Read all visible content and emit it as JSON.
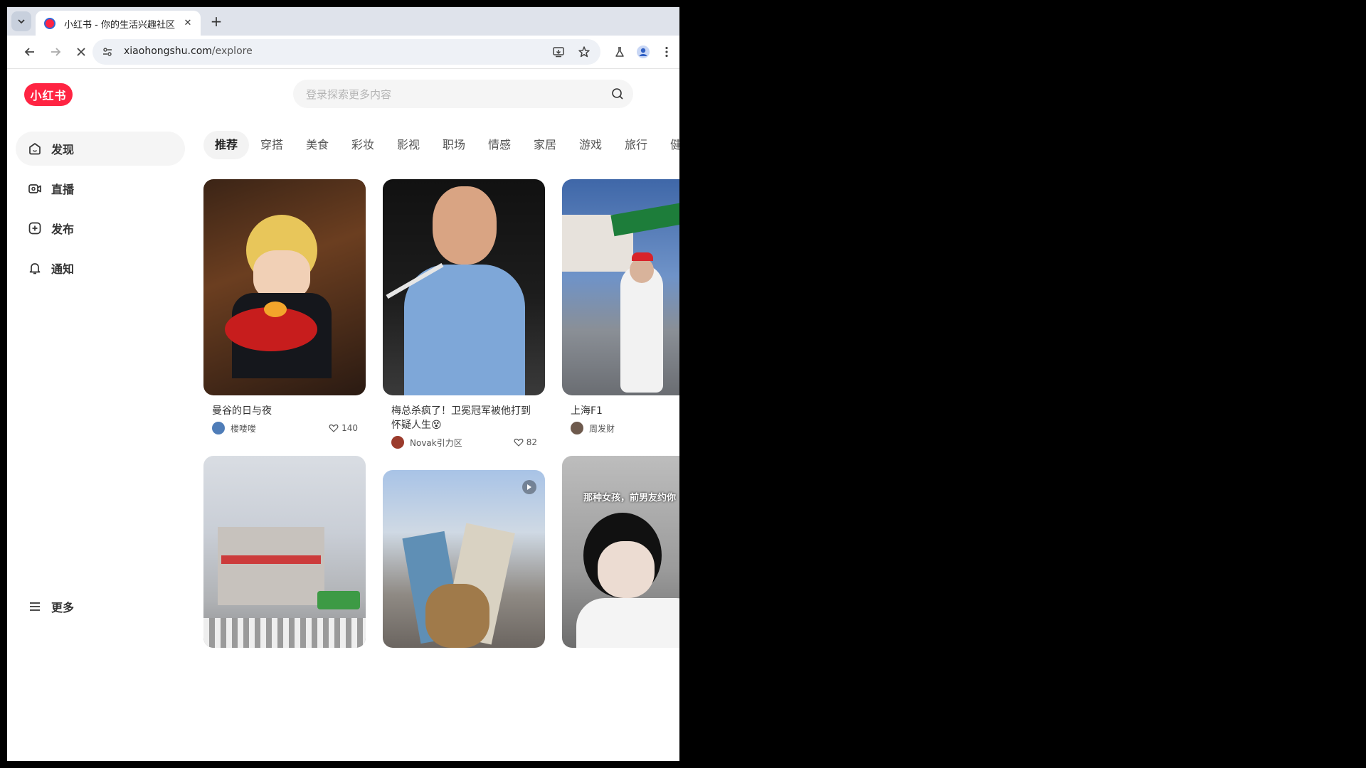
{
  "browser": {
    "tab_title": "小红书 - 你的生活兴趣社区",
    "url_host": "xiaohongshu.com",
    "url_path": "/explore"
  },
  "page": {
    "logo_text": "小红书",
    "search_placeholder": "登录探索更多内容",
    "sidebar": {
      "items": [
        {
          "label": "发现",
          "icon": "home-icon",
          "active": true
        },
        {
          "label": "直播",
          "icon": "live-icon"
        },
        {
          "label": "发布",
          "icon": "add-icon"
        },
        {
          "label": "通知",
          "icon": "bell-icon"
        }
      ],
      "more_label": "更多"
    },
    "channels": [
      "推荐",
      "穿搭",
      "美食",
      "彩妆",
      "影视",
      "职场",
      "情感",
      "家居",
      "游戏",
      "旅行",
      "健"
    ],
    "feed": [
      {
        "title": "曼谷的日与夜",
        "author": "楼喽喽",
        "likes": "140",
        "cover_desc": "person-with-birthday-cake"
      },
      {
        "title": "梅总杀疯了！卫冕冠军被他打到怀疑人生😵",
        "author": "Novak引力区",
        "likes": "82",
        "cover_desc": "tennis-player"
      },
      {
        "title": "上海F1",
        "author": "周发财",
        "likes": "",
        "cover_desc": "f1-fan-photo"
      },
      {
        "title": "",
        "author": "",
        "likes": "",
        "cover_desc": "street-corner-buildings"
      },
      {
        "title": "",
        "author": "",
        "likes": "",
        "cover_desc": "hand-holding-gifts",
        "video": true
      },
      {
        "title": "",
        "author": "",
        "likes": "",
        "cover_desc": "selfie-portrait",
        "overlay_text": "那种女孩，前男友约你"
      }
    ]
  },
  "colors": {
    "brand": "#ff2442",
    "tabstrip": "#dfe3eb",
    "omnibox": "#eef1f6"
  }
}
